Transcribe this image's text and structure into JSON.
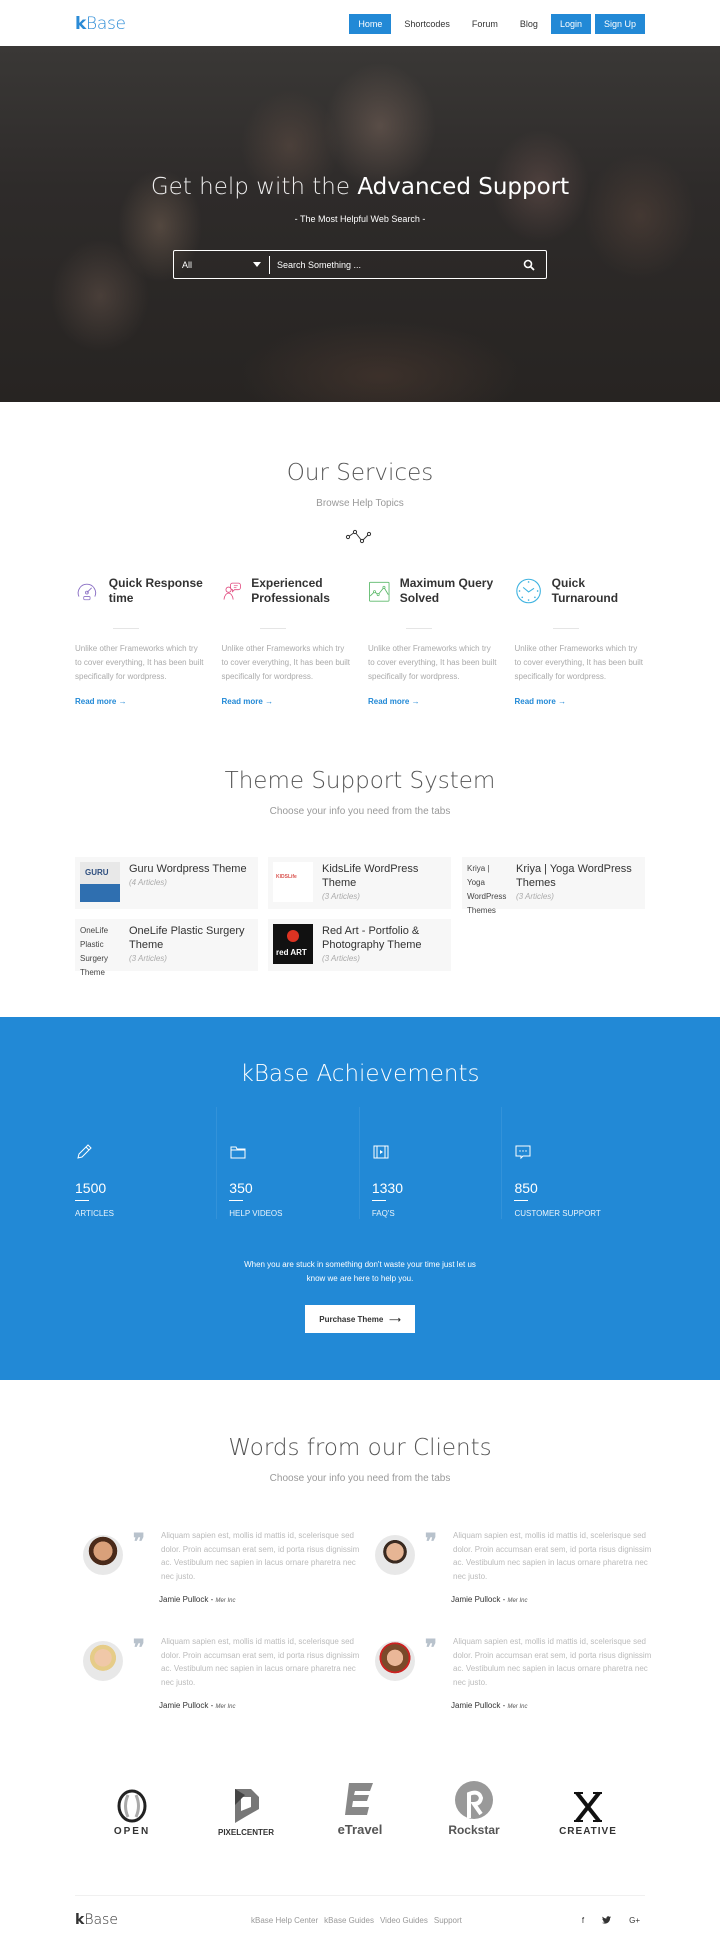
{
  "header": {
    "logo_bold": "k",
    "logo_rest": "Base",
    "nav": [
      {
        "label": "Home",
        "active": true
      },
      {
        "label": "Shortcodes"
      },
      {
        "label": "Forum"
      },
      {
        "label": "Blog"
      },
      {
        "label": "Login",
        "button": true
      },
      {
        "label": "Sign Up",
        "button": true
      }
    ]
  },
  "hero": {
    "title_light": "Get help with the",
    "title_strong": "Advanced Support",
    "subtitle": "- The Most Helpful Web Search -",
    "search": {
      "category_value": "All",
      "placeholder": "Search Something ...",
      "icon": "search-icon"
    }
  },
  "services": {
    "title": "Our Services",
    "subtitle": "Browse Help Topics",
    "items": [
      {
        "title": "Quick Response time",
        "icon": "speedometer-icon",
        "color": "#8a6fc4",
        "text": "Unlike other Frameworks which try to cover everything, It has been built specifically for wordpress.",
        "link": "Read more"
      },
      {
        "title": "Experienced Professionals",
        "icon": "chat-person-icon",
        "color": "#e0457b",
        "text": "Unlike other Frameworks which try to cover everything, It has been built specifically for wordpress.",
        "link": "Read more"
      },
      {
        "title": "Maximum Query Solved",
        "icon": "line-chart-icon",
        "color": "#5cb96a",
        "text": "Unlike other Frameworks which try to cover everything, It has been built specifically for wordpress.",
        "link": "Read more"
      },
      {
        "title": "Quick Turnaround",
        "icon": "clock-icon",
        "color": "#3fb3e0",
        "text": "Unlike other Frameworks which try to cover everything, It has been built specifically for wordpress.",
        "link": "Read more"
      }
    ]
  },
  "themes": {
    "title": "Theme Support System",
    "subtitle": "Choose your info you need from the tabs",
    "items": [
      {
        "name": "Guru Wordpress Theme",
        "count": "(4 Articles)",
        "thumb_alt": "GURU"
      },
      {
        "name": "KidsLife WordPress Theme",
        "count": "(3 Articles)",
        "thumb_alt": "KIDSLife"
      },
      {
        "name": "Kriya | Yoga WordPress Themes",
        "count": "(3 Articles)",
        "thumb_alt": "Kriya | Yoga WordPress Themes"
      },
      {
        "name": "OneLife Plastic Surgery Theme",
        "count": "(3 Articles)",
        "thumb_alt": "OneLife Plastic Surgery Theme"
      },
      {
        "name": "Red Art - Portfolio & Photography Theme",
        "count": "(3 Articles)",
        "thumb_alt": "red ART"
      }
    ]
  },
  "achievements": {
    "title": "kBase Achievements",
    "stats": [
      {
        "value": "1500",
        "label": "ARTICLES",
        "icon": "pencil-icon"
      },
      {
        "value": "350",
        "label": "HELP VIDEOS",
        "icon": "folder-icon"
      },
      {
        "value": "1330",
        "label": "FAQ'S",
        "icon": "video-icon"
      },
      {
        "value": "850",
        "label": "CUSTOMER SUPPORT",
        "icon": "chat-icon"
      }
    ],
    "text_line1": "When you are stuck in something don't waste your time just let us",
    "text_line2": "know we are here to help you.",
    "button": "Purchase Theme",
    "accent": "#2289d6"
  },
  "clients": {
    "title": "Words from our Clients",
    "subtitle": "Choose your info you need from the tabs",
    "testimonials": [
      {
        "text": "Aliquam sapien est, mollis id mattis id, scelerisque sed dolor. Proin accumsan erat sem, id porta risus dignissim ac. Vestibulum nec sapien in lacus ornare pharetra nec nec justo.",
        "author": "Jamie Pullock",
        "company": "Mer Inc"
      },
      {
        "text": "Aliquam sapien est, mollis id mattis id, scelerisque sed dolor. Proin accumsan erat sem, id porta risus dignissim ac. Vestibulum nec sapien in lacus ornare pharetra nec nec justo.",
        "author": "Jamie Pullock",
        "company": "Mer Inc"
      },
      {
        "text": "Aliquam sapien est, mollis id mattis id, scelerisque sed dolor. Proin accumsan erat sem, id porta risus dignissim ac. Vestibulum nec sapien in lacus ornare pharetra nec nec justo.",
        "author": "Jamie Pullock",
        "company": "Mer Inc"
      },
      {
        "text": "Aliquam sapien est, mollis id mattis id, scelerisque sed dolor. Proin accumsan erat sem, id porta risus dignissim ac. Vestibulum nec sapien in lacus ornare pharetra nec nec justo.",
        "author": "Jamie Pullock",
        "company": "Mer Inc"
      }
    ]
  },
  "partners": [
    "OPEN",
    "PIXELCENTER",
    "eTravel",
    "Rockstar",
    "CREATIVE"
  ],
  "footer": {
    "logo_bold": "k",
    "logo_rest": "Base",
    "links": [
      "kBase Help Center",
      "kBase Guides",
      "Video Guides",
      "Support"
    ],
    "social": [
      "f",
      "t",
      "G+"
    ]
  }
}
